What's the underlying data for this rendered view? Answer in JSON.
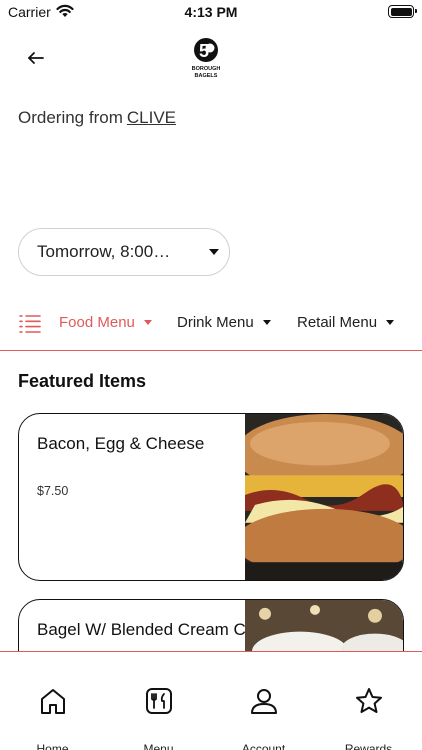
{
  "status_bar": {
    "carrier": "Carrier",
    "time": "4:13 PM"
  },
  "header": {
    "back_icon": "arrow-left-icon",
    "logo_number": "5",
    "logo_line1": "BOROUGH",
    "logo_line2": "BAGELS"
  },
  "ordering": {
    "prefix": "Ordering from",
    "location": "CLIVE"
  },
  "time_select": {
    "value": "Tomorrow, 8:00…"
  },
  "menu_tabs": [
    {
      "label": "Food Menu",
      "active": true
    },
    {
      "label": "Drink Menu",
      "active": false
    },
    {
      "label": "Retail Menu",
      "active": false
    }
  ],
  "featured": {
    "title": "Featured Items",
    "items": [
      {
        "name": "Bacon, Egg & Cheese",
        "price": "$7.50"
      },
      {
        "name": "Bagel W/ Blended Cream Cheese",
        "price": ""
      }
    ]
  },
  "bottom_nav": [
    {
      "label": "Home",
      "icon": "home-icon"
    },
    {
      "label": "Menu",
      "icon": "menu-utensils-icon"
    },
    {
      "label": "Account",
      "icon": "user-icon"
    },
    {
      "label": "Rewards",
      "icon": "star-icon"
    }
  ],
  "colors": {
    "accent": "#e05a5a",
    "text": "#111111",
    "border": "#d0d0d0"
  }
}
